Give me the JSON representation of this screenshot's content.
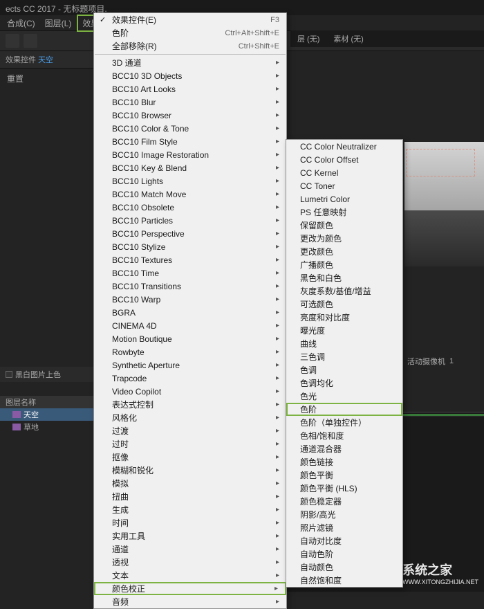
{
  "titlebar": "ects CC 2017 - 无标题项目.",
  "menubar": {
    "compose": "合成(C)",
    "layer": "图层(L)",
    "effects": "效果(T)"
  },
  "panel": {
    "tab_label": "效果控件",
    "tab_target": "天空",
    "header": "重置"
  },
  "viewer": {
    "layer": "层 (无)",
    "material": "素材 (无)",
    "camera": "活动摄像机",
    "zoom": "1 "
  },
  "menu": {
    "items": [
      {
        "label": "效果控件(E)",
        "shortcut": "F3",
        "check": true
      },
      {
        "label": "色阶",
        "shortcut": "Ctrl+Alt+Shift+E"
      },
      {
        "label": "全部移除(R)",
        "shortcut": "Ctrl+Shift+E"
      },
      {
        "sep": true
      },
      {
        "label": "3D 通道",
        "sub": true
      },
      {
        "label": "BCC10 3D Objects",
        "sub": true
      },
      {
        "label": "BCC10 Art Looks",
        "sub": true
      },
      {
        "label": "BCC10 Blur",
        "sub": true
      },
      {
        "label": "BCC10 Browser",
        "sub": true
      },
      {
        "label": "BCC10 Color & Tone",
        "sub": true
      },
      {
        "label": "BCC10 Film Style",
        "sub": true
      },
      {
        "label": "BCC10 Image Restoration",
        "sub": true
      },
      {
        "label": "BCC10 Key & Blend",
        "sub": true
      },
      {
        "label": "BCC10 Lights",
        "sub": true
      },
      {
        "label": "BCC10 Match Move",
        "sub": true
      },
      {
        "label": "BCC10 Obsolete",
        "sub": true
      },
      {
        "label": "BCC10 Particles",
        "sub": true
      },
      {
        "label": "BCC10 Perspective",
        "sub": true
      },
      {
        "label": "BCC10 Stylize",
        "sub": true
      },
      {
        "label": "BCC10 Textures",
        "sub": true
      },
      {
        "label": "BCC10 Time",
        "sub": true
      },
      {
        "label": "BCC10 Transitions",
        "sub": true
      },
      {
        "label": "BCC10 Warp",
        "sub": true
      },
      {
        "label": "BGRA",
        "sub": true
      },
      {
        "label": "CINEMA 4D",
        "sub": true
      },
      {
        "label": "Motion Boutique",
        "sub": true
      },
      {
        "label": "Rowbyte",
        "sub": true
      },
      {
        "label": "Synthetic Aperture",
        "sub": true
      },
      {
        "label": "Trapcode",
        "sub": true
      },
      {
        "label": "Video Copilot",
        "sub": true
      },
      {
        "label": "表达式控制",
        "sub": true
      },
      {
        "label": "风格化",
        "sub": true
      },
      {
        "label": "过渡",
        "sub": true
      },
      {
        "label": "过时",
        "sub": true
      },
      {
        "label": "抠像",
        "sub": true
      },
      {
        "label": "模糊和锐化",
        "sub": true
      },
      {
        "label": "模拟",
        "sub": true
      },
      {
        "label": "扭曲",
        "sub": true
      },
      {
        "label": "生成",
        "sub": true
      },
      {
        "label": "时间",
        "sub": true
      },
      {
        "label": "实用工具",
        "sub": true
      },
      {
        "label": "通道",
        "sub": true
      },
      {
        "label": "透视",
        "sub": true
      },
      {
        "label": "文本",
        "sub": true
      },
      {
        "label": "颜色校正",
        "sub": true,
        "highlighted": true
      },
      {
        "label": "音频",
        "sub": true
      }
    ]
  },
  "submenu": {
    "items": [
      "CC Color Neutralizer",
      "CC Color Offset",
      "CC Kernel",
      "CC Toner",
      "Lumetri Color",
      "PS 任意映射",
      "保留颜色",
      "更改为颜色",
      "更改颜色",
      "广播颜色",
      "黑色和白色",
      "灰度系数/基值/增益",
      "可选颜色",
      "亮度和对比度",
      "曝光度",
      "曲线",
      "三色调",
      "色调",
      "色调均化",
      "色光",
      "色阶",
      "色阶（单独控件）",
      "色相/饱和度",
      "通道混合器",
      "颜色链接",
      "颜色平衡",
      "颜色平衡 (HLS)",
      "颜色稳定器",
      "阴影/高光",
      "照片滤镜",
      "自动对比度",
      "自动色阶",
      "自动颜色",
      "自然饱和度"
    ],
    "highlighted_index": 20
  },
  "bottom": {
    "tab": "黑白图片上色",
    "header": "图层名称",
    "rows": [
      {
        "label": "天空",
        "selected": true
      },
      {
        "label": "草地",
        "selected": false
      }
    ]
  },
  "watermark": {
    "title": "系统之家",
    "url": "WWW.XITONGZHIJIA.NET"
  }
}
